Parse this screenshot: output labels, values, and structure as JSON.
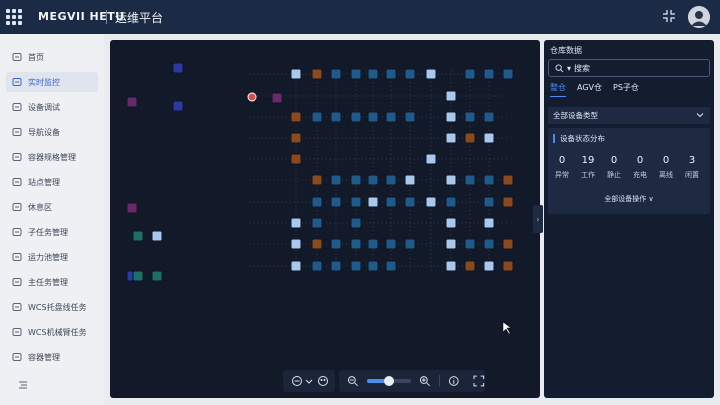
{
  "header": {
    "brand": "MEGVII HETU",
    "title": "运维平台"
  },
  "sidebar": {
    "items": [
      {
        "label": "首页",
        "icon": "home-icon",
        "active": false
      },
      {
        "label": "实时监控",
        "icon": "monitor-icon",
        "active": true
      },
      {
        "label": "设备调试",
        "icon": "debug-icon",
        "active": false
      },
      {
        "label": "导航设备",
        "icon": "navigation-icon",
        "active": false
      },
      {
        "label": "容器规格管理",
        "icon": "container-spec-icon",
        "active": false
      },
      {
        "label": "站点管理",
        "icon": "station-icon",
        "active": false
      },
      {
        "label": "休息区",
        "icon": "rest-area-icon",
        "active": false
      },
      {
        "label": "子任务管理",
        "icon": "subtask-icon",
        "active": false
      },
      {
        "label": "运力池管理",
        "icon": "capacity-pool-icon",
        "active": false
      },
      {
        "label": "主任务管理",
        "icon": "main-task-icon",
        "active": false
      },
      {
        "label": "WCS托盘线任务",
        "icon": "pallet-line-icon",
        "active": false
      },
      {
        "label": "WCS机械臂任务",
        "icon": "robot-arm-icon",
        "active": false
      },
      {
        "label": "容器管理",
        "icon": "container-icon",
        "active": false
      }
    ]
  },
  "panel": {
    "title": "仓库数据",
    "search": {
      "prefix": "▾",
      "placeholder": "搜索"
    },
    "tabs": [
      {
        "label": "整仓",
        "active": true
      },
      {
        "label": "AGV仓",
        "active": false
      },
      {
        "label": "PS子仓",
        "active": false
      }
    ],
    "device_type_select": "全部设备类型",
    "status": {
      "title": "设备状态分布",
      "stats": [
        {
          "value": "0",
          "label": "异常"
        },
        {
          "value": "19",
          "label": "工作"
        },
        {
          "value": "0",
          "label": "静止"
        },
        {
          "value": "0",
          "label": "充电"
        },
        {
          "value": "0",
          "label": "离线"
        },
        {
          "value": "3",
          "label": "闲置"
        }
      ],
      "operations": "全部设备操作 ∨"
    }
  },
  "map_toolbar": {
    "zoom_level": 0.5
  },
  "colors": {
    "accent": "#4a8cf0",
    "header_bg": "#1b2a45",
    "map_bg": "#121a2a"
  }
}
